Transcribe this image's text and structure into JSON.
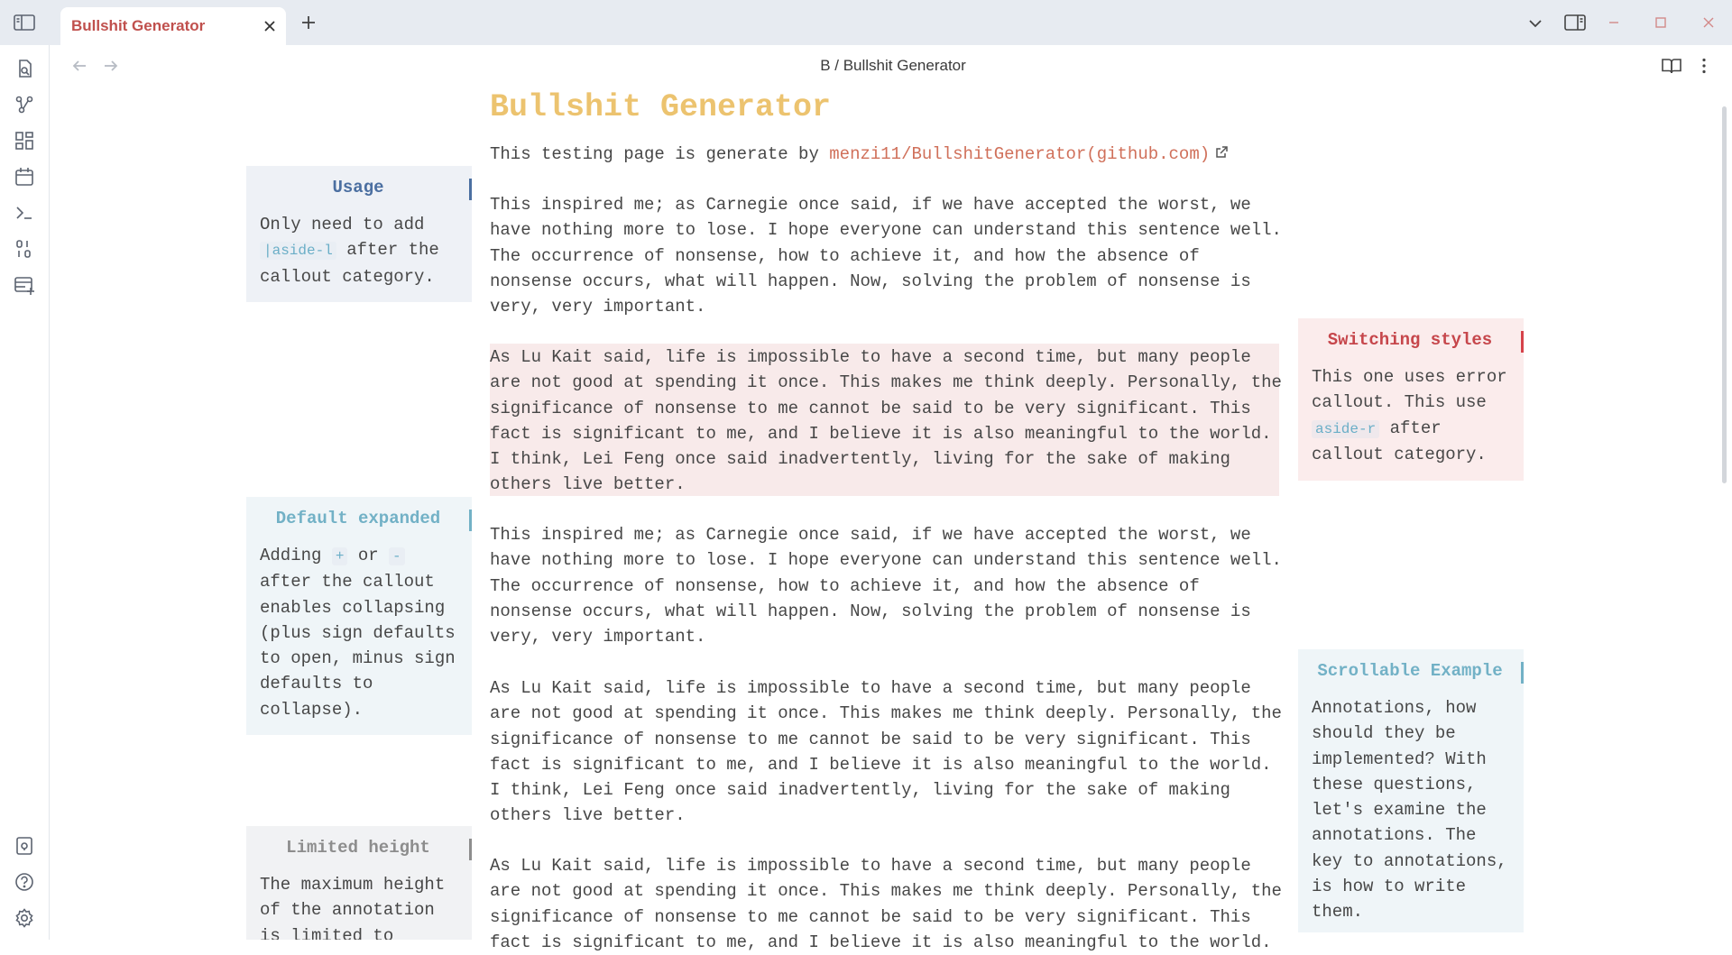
{
  "tab": {
    "title": "Bullshit Generator"
  },
  "header": {
    "breadcrumb": "B / Bullshit Generator"
  },
  "icons": {
    "sidebar_toggle": "sidebar-left-icon",
    "tab_close": "close-icon",
    "new_tab": "plus-icon",
    "tab_list": "chevron-down-icon",
    "right_sidebar": "sidebar-right-icon",
    "minimize": "minimize-icon",
    "maximize": "maximize-icon",
    "close_window": "close-icon",
    "ribbon_top": [
      "quick-switcher-icon",
      "graph-view-icon",
      "canvas-icon",
      "daily-note-icon",
      "command-palette-icon",
      "templates-icon",
      "bases-icon"
    ],
    "ribbon_bottom": [
      "vault-switcher-icon",
      "help-icon",
      "settings-icon"
    ],
    "nav_back": "arrow-left-icon",
    "nav_forward": "arrow-right-icon",
    "reading_view": "book-open-icon",
    "more_options": "more-vertical-icon",
    "external_link": "external-link-icon"
  },
  "colors": {
    "accent": "#c0504d",
    "title": "#ecc36f",
    "link": "#d0705a",
    "usage_callout": "#4b6fa1",
    "error_callout": "#c6464b",
    "info_callout": "#72b1c6"
  },
  "content": {
    "title": "Bullshit Generator",
    "intro_prefix": "This testing page is generate by ",
    "intro_link": "menzi11/BullshitGenerator(github.com)",
    "para_1": "This inspired me; as Carnegie once said, if we have accepted the worst, we have nothing more to lose. I hope everyone can understand this sentence well. The occurrence of nonsense, how to achieve it, and how the absence of nonsense occurs, what will happen. Now, solving the problem of nonsense is very, very important.",
    "para_2": "As Lu Kait said, life is impossible to have a second time, but many people are not good at spending it once. This makes me think deeply. Personally, the significance of nonsense to me cannot be said to be very significant. This fact is significant to me, and I believe it is also meaningful to the world. I think, Lei Feng once said inadvertently, living for the sake of making others live better.",
    "para_3": "This inspired me; as Carnegie once said, if we have accepted the worst, we have nothing more to lose. I hope everyone can understand this sentence well. The occurrence of nonsense, how to achieve it, and how the absence of nonsense occurs, what will happen. Now, solving the problem of nonsense is very, very important.",
    "para_4": "As Lu Kait said, life is impossible to have a second time, but many people are not good at spending it once. This makes me think deeply. Personally, the significance of nonsense to me cannot be said to be very significant. This fact is significant to me, and I believe it is also meaningful to the world. I think, Lei Feng once said inadvertently, living for the sake of making others live better.",
    "para_5": "As Lu Kait said, life is impossible to have a second time, but many people are not good at spending it once. This makes me think deeply. Personally, the significance of nonsense to me cannot be said to be very significant. This fact is significant to me, and I believe it is also meaningful to the world."
  },
  "callouts": {
    "usage": {
      "title": "Usage",
      "text_before": "Only need to add ",
      "code": "|aside-l",
      "text_after": " after the callout category."
    },
    "switching": {
      "title": "Switching styles",
      "text_before": "This one uses error callout. This use ",
      "code": "aside-r",
      "text_after": " after callout category."
    },
    "default_expanded": {
      "title": "Default expanded",
      "text_before": "Adding ",
      "code_plus": "+",
      "text_mid": " or ",
      "code_minus": "-",
      "text_after": " after the callout enables collapsing (plus sign defaults to open, minus sign defaults to collapse)."
    },
    "scrollable": {
      "title": "Scrollable Example",
      "text": "Annotations, how should they be implemented? With these questions, let's examine the annotations. The key to annotations, is how to write them."
    },
    "limited": {
      "title": "Limited height",
      "text": "The maximum height of the annotation is limited to"
    }
  }
}
